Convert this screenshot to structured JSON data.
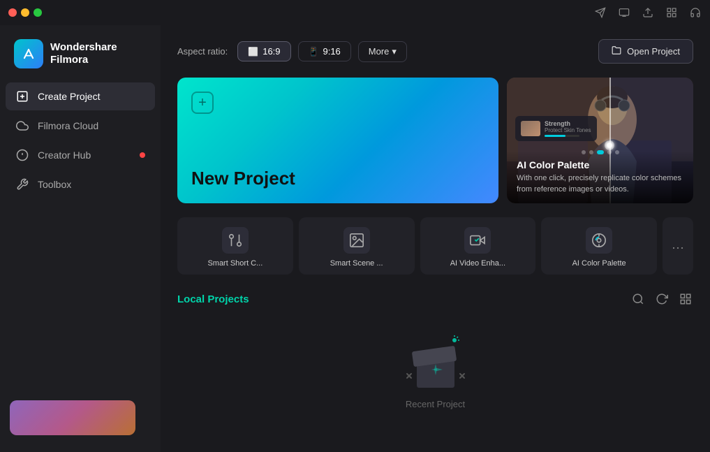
{
  "titlebar": {
    "dots": [
      "red",
      "yellow",
      "green"
    ],
    "icons": [
      "share-icon",
      "screen-icon",
      "upload-icon",
      "grid-icon",
      "headphone-icon"
    ]
  },
  "sidebar": {
    "logo": {
      "icon_char": "◈",
      "brand_name": "Wondershare",
      "app_name": "Filmora"
    },
    "nav_items": [
      {
        "id": "create-project",
        "label": "Create Project",
        "icon": "➕",
        "active": true,
        "badge": false
      },
      {
        "id": "filmora-cloud",
        "label": "Filmora Cloud",
        "icon": "☁",
        "active": false,
        "badge": false
      },
      {
        "id": "creator-hub",
        "label": "Creator Hub",
        "icon": "💡",
        "active": false,
        "badge": true
      },
      {
        "id": "toolbox",
        "label": "Toolbox",
        "icon": "🧰",
        "active": false,
        "badge": false
      }
    ]
  },
  "header": {
    "aspect_ratio_label": "Aspect ratio:",
    "aspect_options": [
      {
        "id": "16-9",
        "label": "16:9",
        "icon": "⬜",
        "active": true
      },
      {
        "id": "9-16",
        "label": "9:16",
        "icon": "📱",
        "active": false
      }
    ],
    "more_button": "More",
    "open_project_button": "Open Project"
  },
  "new_project": {
    "title": "New Project"
  },
  "ai_card": {
    "title": "AI Color Palette",
    "description": "With one click, precisely replicate color schemes from reference images or videos."
  },
  "ai_tools": [
    {
      "id": "smart-short-cut",
      "label": "Smart Short C...",
      "icon": "✂️"
    },
    {
      "id": "smart-scene",
      "label": "Smart Scene ...",
      "icon": "🎬"
    },
    {
      "id": "ai-video-enhance",
      "label": "AI Video Enha...",
      "icon": "✨"
    },
    {
      "id": "ai-color-palette",
      "label": "AI Color Palette",
      "icon": "🎨"
    },
    {
      "id": "more",
      "label": "···",
      "icon": "···"
    }
  ],
  "local_projects": {
    "title": "Local Projects",
    "empty_label": "Recent Project",
    "actions": [
      "search",
      "refresh",
      "grid"
    ]
  }
}
